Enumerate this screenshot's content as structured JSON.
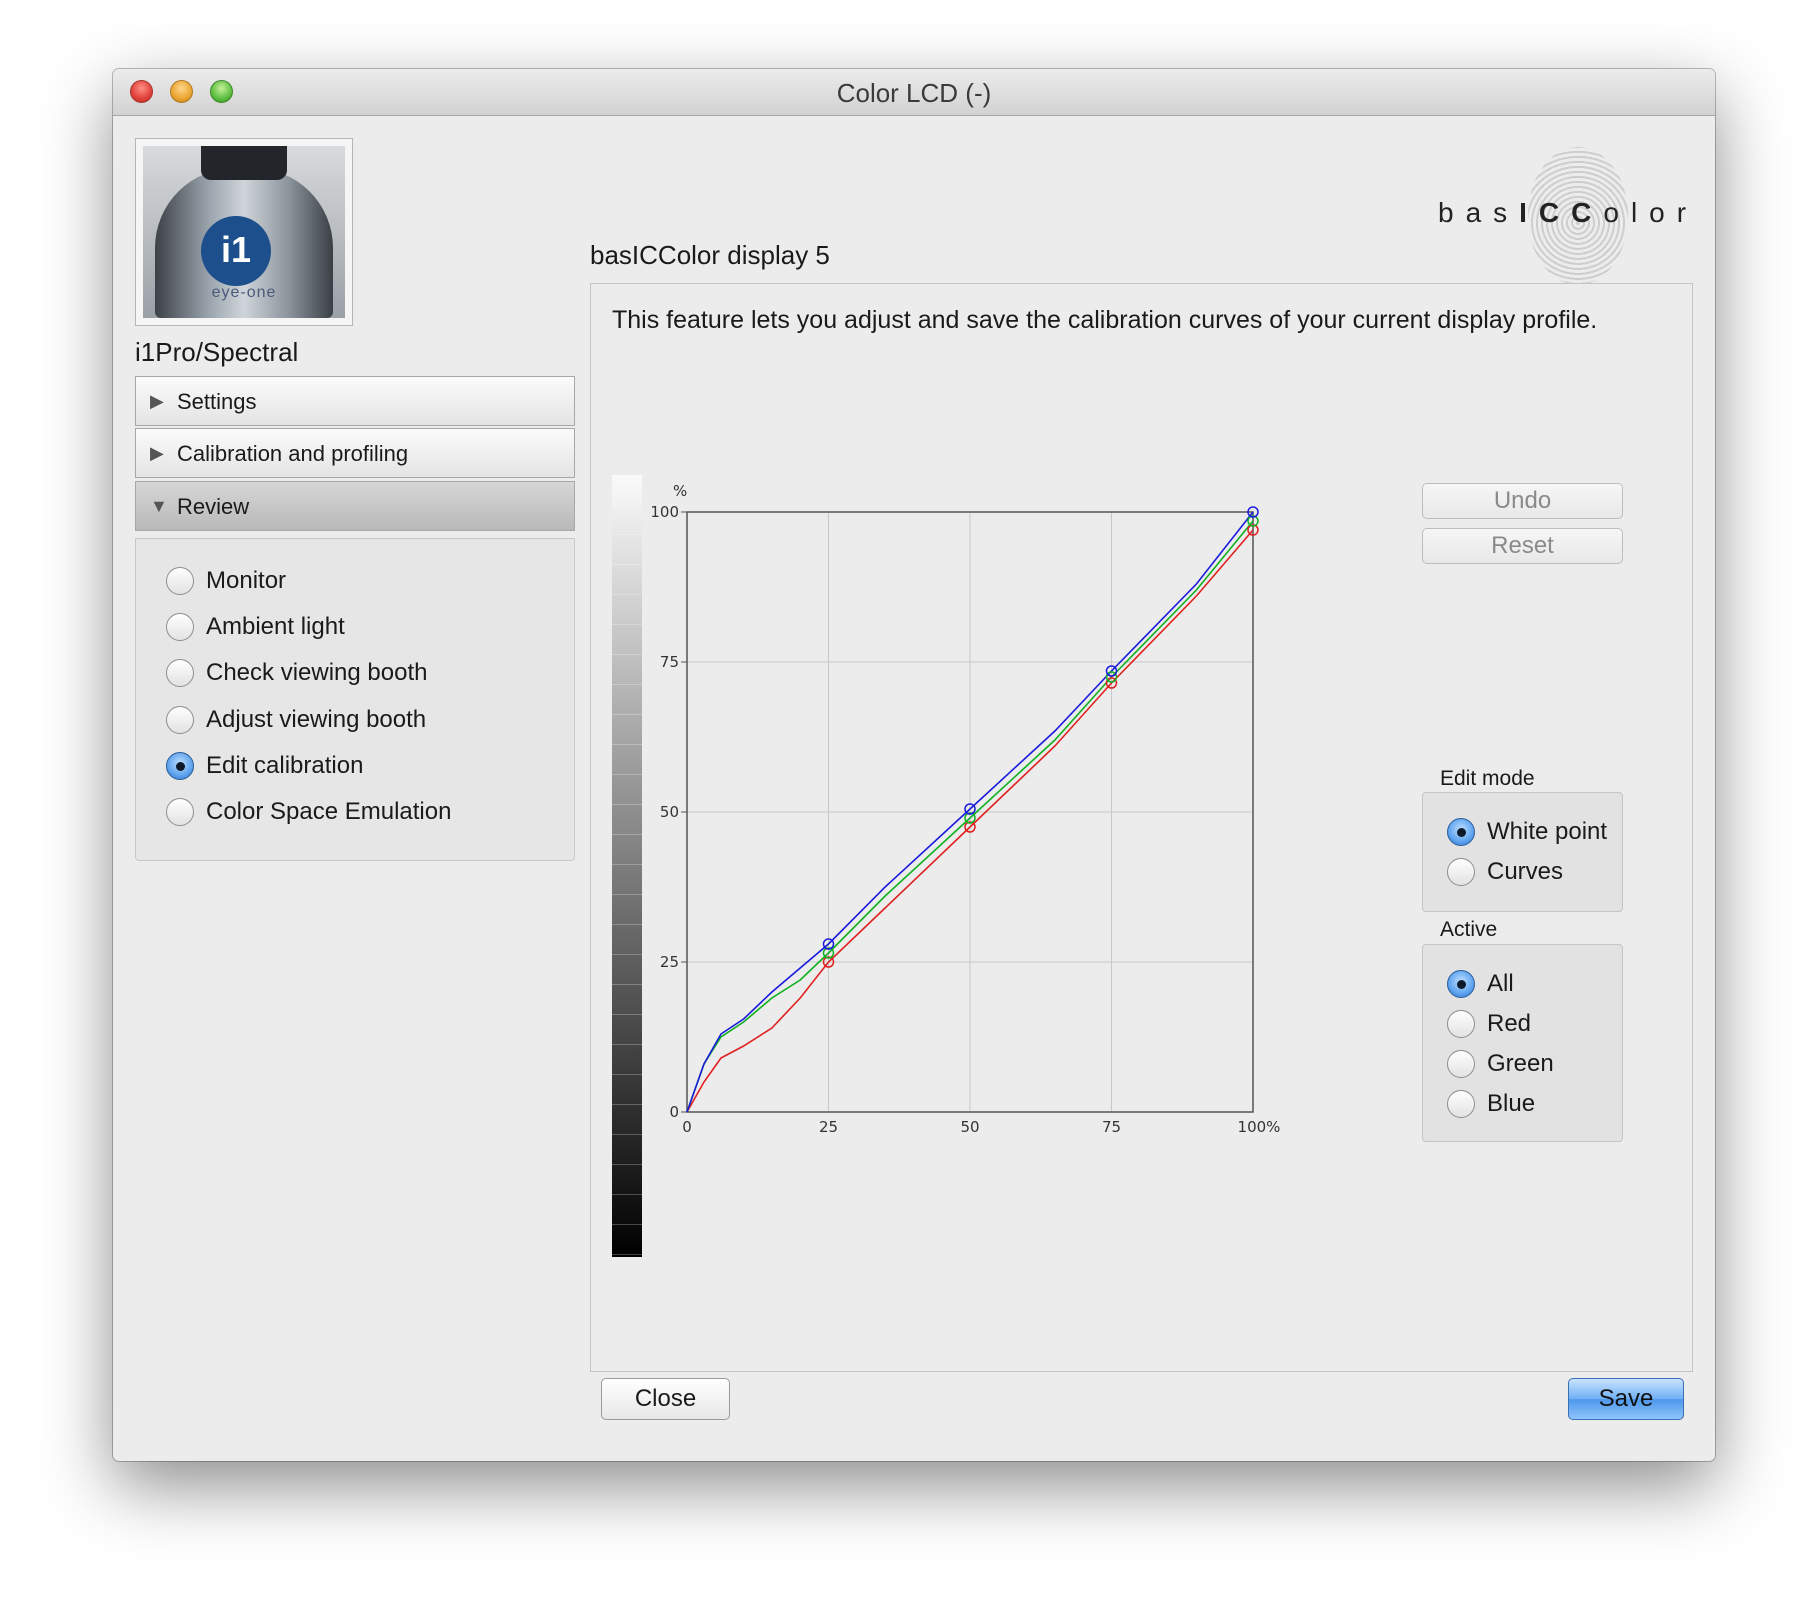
{
  "window": {
    "title": "Color LCD (-)"
  },
  "sidebar": {
    "device_logo_text": "i1",
    "device_brand_text": "eye-one",
    "device_name": "i1Pro/Spectral",
    "sections": [
      {
        "label": "Settings",
        "expanded": false
      },
      {
        "label": "Calibration and profiling",
        "expanded": false
      },
      {
        "label": "Review",
        "expanded": true
      }
    ],
    "review_items": [
      {
        "label": "Monitor",
        "checked": false
      },
      {
        "label": "Ambient light",
        "checked": false
      },
      {
        "label": "Check viewing booth",
        "checked": false
      },
      {
        "label": "Adjust viewing booth",
        "checked": false
      },
      {
        "label": "Edit calibration",
        "checked": true
      },
      {
        "label": "Color Space Emulation",
        "checked": false
      }
    ]
  },
  "header": {
    "app_title": "basICColor display 5",
    "brand": {
      "prefix": "bas",
      "bold": "ICC",
      "suffix": "olor"
    }
  },
  "main": {
    "description": "This feature lets you adjust and save the calibration curves of your current display profile."
  },
  "buttons": {
    "undo": "Undo",
    "reset": "Reset",
    "close": "Close",
    "save": "Save"
  },
  "edit_mode": {
    "label": "Edit mode",
    "options": [
      {
        "label": "White point",
        "checked": true
      },
      {
        "label": "Curves",
        "checked": false
      }
    ]
  },
  "active": {
    "label": "Active",
    "options": [
      {
        "label": "All",
        "checked": true
      },
      {
        "label": "Red",
        "checked": false
      },
      {
        "label": "Green",
        "checked": false
      },
      {
        "label": "Blue",
        "checked": false
      }
    ]
  },
  "chart_data": {
    "type": "line",
    "y_unit": "%",
    "x_tick_labels": [
      "0",
      "25",
      "50",
      "75",
      "100%"
    ],
    "y_tick_labels": [
      "0",
      "25",
      "50",
      "75",
      "100"
    ],
    "xlim": [
      0,
      100
    ],
    "ylim": [
      0,
      100
    ],
    "grid": true,
    "colors": {
      "red": "#e02020",
      "green": "#10b020",
      "blue": "#1a1adc"
    },
    "series": [
      {
        "key": "red",
        "x": [
          0,
          3,
          6,
          10,
          15,
          20,
          25,
          35,
          50,
          65,
          75,
          90,
          100
        ],
        "y": [
          0,
          5,
          9,
          11,
          14,
          19,
          25,
          34,
          47.5,
          61,
          71.5,
          86,
          97
        ]
      },
      {
        "key": "green",
        "x": [
          0,
          3,
          6,
          10,
          15,
          20,
          25,
          35,
          50,
          65,
          75,
          90,
          100
        ],
        "y": [
          0,
          8,
          12.5,
          15,
          19,
          22,
          26.5,
          36,
          49,
          62,
          72.5,
          87,
          98.5
        ]
      },
      {
        "key": "blue",
        "x": [
          0,
          3,
          6,
          10,
          15,
          20,
          25,
          35,
          50,
          65,
          75,
          90,
          100
        ],
        "y": [
          0,
          8,
          13,
          15.5,
          20,
          24,
          28,
          37.5,
          50.5,
          63.5,
          73.5,
          88,
          100
        ]
      }
    ],
    "control_points": {
      "x": [
        25,
        50,
        75,
        100
      ],
      "red": [
        25,
        47.5,
        71.5,
        97
      ],
      "green": [
        26.5,
        49,
        72.5,
        98.5
      ],
      "blue": [
        28,
        50.5,
        73.5,
        100
      ]
    }
  }
}
